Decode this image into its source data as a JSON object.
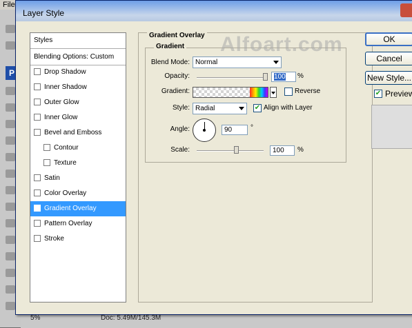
{
  "background": {
    "menu_label": "File",
    "status": {
      "zoom": "5%",
      "doc_info": "Doc: 5.49M/145.3M"
    }
  },
  "dialog": {
    "title": "Layer Style",
    "watermark": "Alfoart.com"
  },
  "styles_list": {
    "header": "Styles",
    "blending_options": "Blending Options: Custom",
    "items": [
      {
        "label": "Drop Shadow",
        "checked": false,
        "indent": false,
        "selected": false
      },
      {
        "label": "Inner Shadow",
        "checked": false,
        "indent": false,
        "selected": false
      },
      {
        "label": "Outer Glow",
        "checked": false,
        "indent": false,
        "selected": false
      },
      {
        "label": "Inner Glow",
        "checked": false,
        "indent": false,
        "selected": false
      },
      {
        "label": "Bevel and Emboss",
        "checked": false,
        "indent": false,
        "selected": false
      },
      {
        "label": "Contour",
        "checked": false,
        "indent": true,
        "selected": false
      },
      {
        "label": "Texture",
        "checked": false,
        "indent": true,
        "selected": false
      },
      {
        "label": "Satin",
        "checked": false,
        "indent": false,
        "selected": false
      },
      {
        "label": "Color Overlay",
        "checked": false,
        "indent": false,
        "selected": false
      },
      {
        "label": "Gradient Overlay",
        "checked": true,
        "indent": false,
        "selected": true
      },
      {
        "label": "Pattern Overlay",
        "checked": false,
        "indent": false,
        "selected": false
      },
      {
        "label": "Stroke",
        "checked": false,
        "indent": false,
        "selected": false
      }
    ]
  },
  "gradient_overlay": {
    "section_title": "Gradient Overlay",
    "group_title": "Gradient",
    "blend_mode": {
      "label": "Blend Mode:",
      "value": "Normal"
    },
    "opacity": {
      "label": "Opacity:",
      "value": "100",
      "unit": "%",
      "level": 1.0
    },
    "gradient": {
      "label": "Gradient:",
      "reverse_label": "Reverse",
      "reverse_checked": false
    },
    "style": {
      "label": "Style:",
      "value": "Radial",
      "align_label": "Align with Layer",
      "align_checked": true
    },
    "angle": {
      "label": "Angle:",
      "value": "90",
      "unit": "°"
    },
    "scale": {
      "label": "Scale:",
      "value": "100",
      "unit": "%",
      "level": 0.6
    }
  },
  "buttons": {
    "ok": "OK",
    "cancel": "Cancel",
    "new_style": "New Style...",
    "preview_label": "Preview",
    "preview_checked": true
  },
  "colors": {
    "selection": "#3399ff",
    "dialog_bg": "#ece9d8",
    "title_bar": "#6d9ee8"
  }
}
